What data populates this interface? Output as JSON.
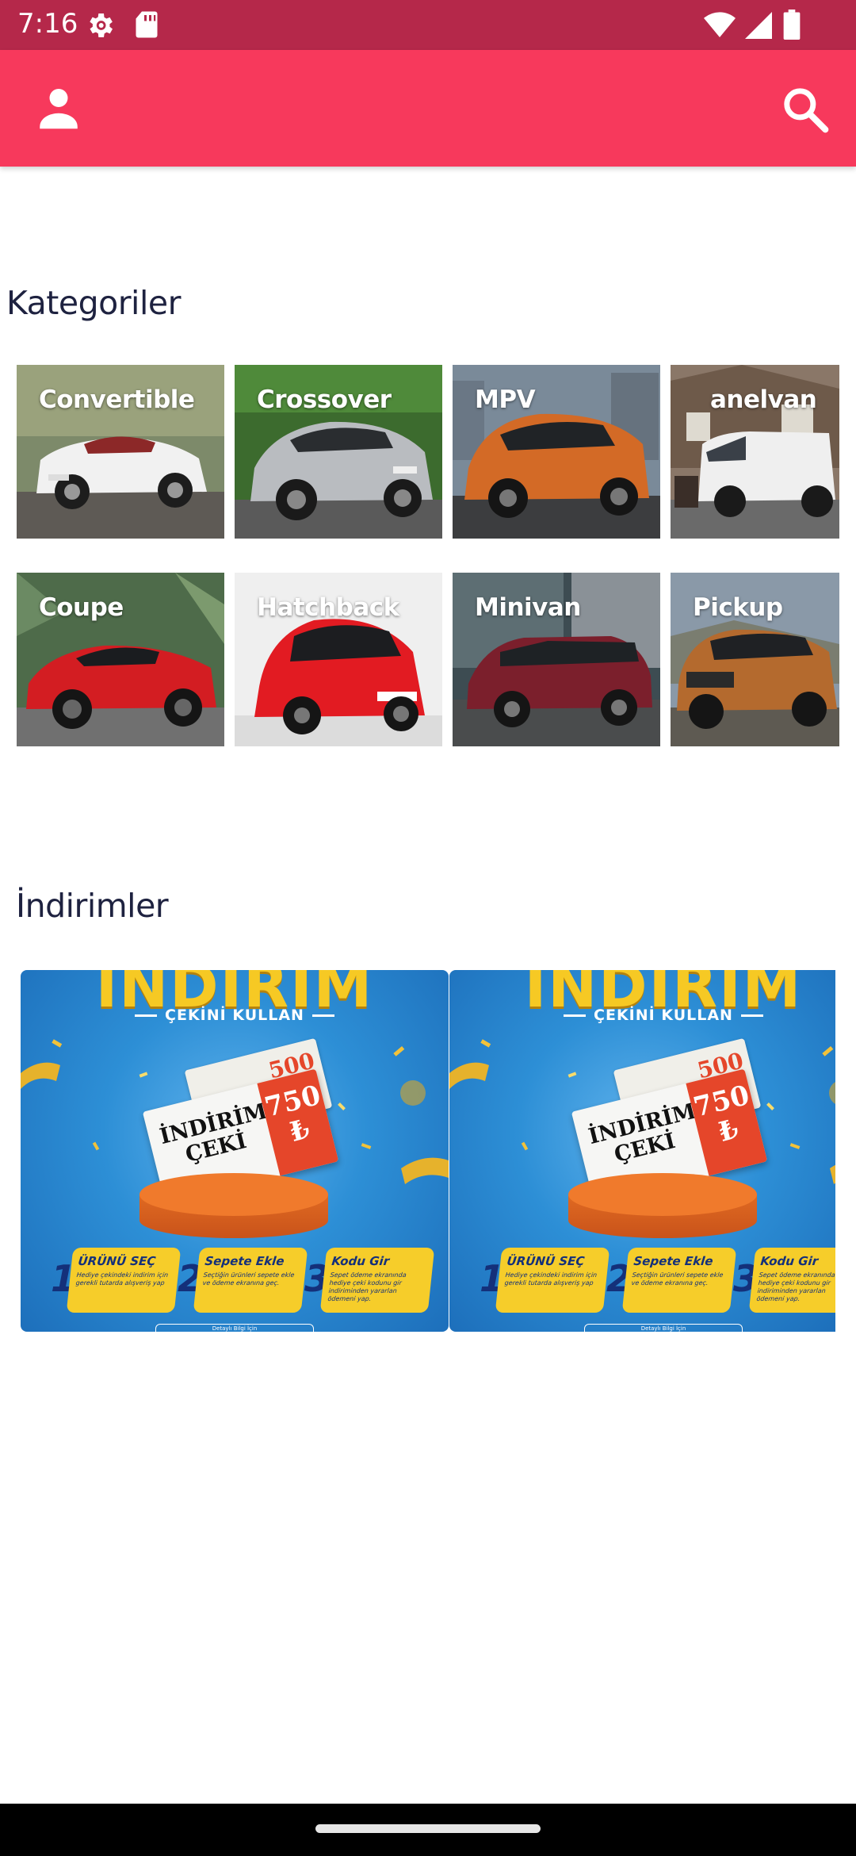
{
  "status_bar": {
    "time": "7:16",
    "icons": [
      "gear-icon",
      "sd-card-icon",
      "wifi-icon",
      "signal-icon",
      "battery-icon"
    ]
  },
  "app_bar": {
    "color": "#f7395c",
    "left_icon": "person-icon",
    "right_icon": "search-icon"
  },
  "categories": {
    "title": "Kategoriler",
    "items": [
      {
        "label": "Convertible"
      },
      {
        "label": "Crossover"
      },
      {
        "label": "MPV"
      },
      {
        "label": "anelvan"
      },
      {
        "label": "Coupe"
      },
      {
        "label": "Hatchback"
      },
      {
        "label": "Minivan"
      },
      {
        "label": "Pickup"
      }
    ]
  },
  "discounts": {
    "title": "İndirimler",
    "banners": [
      {
        "headline": "İNDİRİM",
        "subtitle": "ÇEKİNİ KULLAN",
        "ticket_text": "İNDİRİM ÇEKİ",
        "ticket_amount": "750 ₺",
        "back_amount": "500",
        "steps": [
          {
            "num": "1",
            "title": "ÜRÜNÜ SEÇ",
            "desc": "Hediye çekindeki indirim için gerekli tutarda alışveriş yap"
          },
          {
            "num": "2",
            "title": "Sepete Ekle",
            "desc": "Seçtiğin ürünleri sepete ekle ve ödeme ekranına geç."
          },
          {
            "num": "3",
            "title": "Kodu Gir",
            "desc": "Sepet ödeme ekranında hediye çeki kodunu gir indiriminden yararlan ödemeni yap."
          }
        ],
        "footer": "Detaylı Bilgi İçin"
      },
      {
        "headline": "İNDİRİM",
        "subtitle": "ÇEKİNİ KULLAN",
        "ticket_text": "İNDİRİM ÇEKİ",
        "ticket_amount": "750 ₺",
        "back_amount": "500",
        "steps": [
          {
            "num": "1",
            "title": "ÜRÜNÜ SEÇ",
            "desc": "Hediye çekindeki indirim için gerekli tutarda alışveriş yap"
          },
          {
            "num": "2",
            "title": "Sepete Ekle",
            "desc": "Seçtiğin ürünleri sepete ekle ve ödeme ekranına geç."
          },
          {
            "num": "3",
            "title": "Kodu Gir",
            "desc": "Sepet ödeme ekranında hediye çeki kodunu gir indiriminden yararlan ödemeni yap."
          }
        ],
        "footer": "Detaylı Bilgi İçin"
      }
    ]
  }
}
